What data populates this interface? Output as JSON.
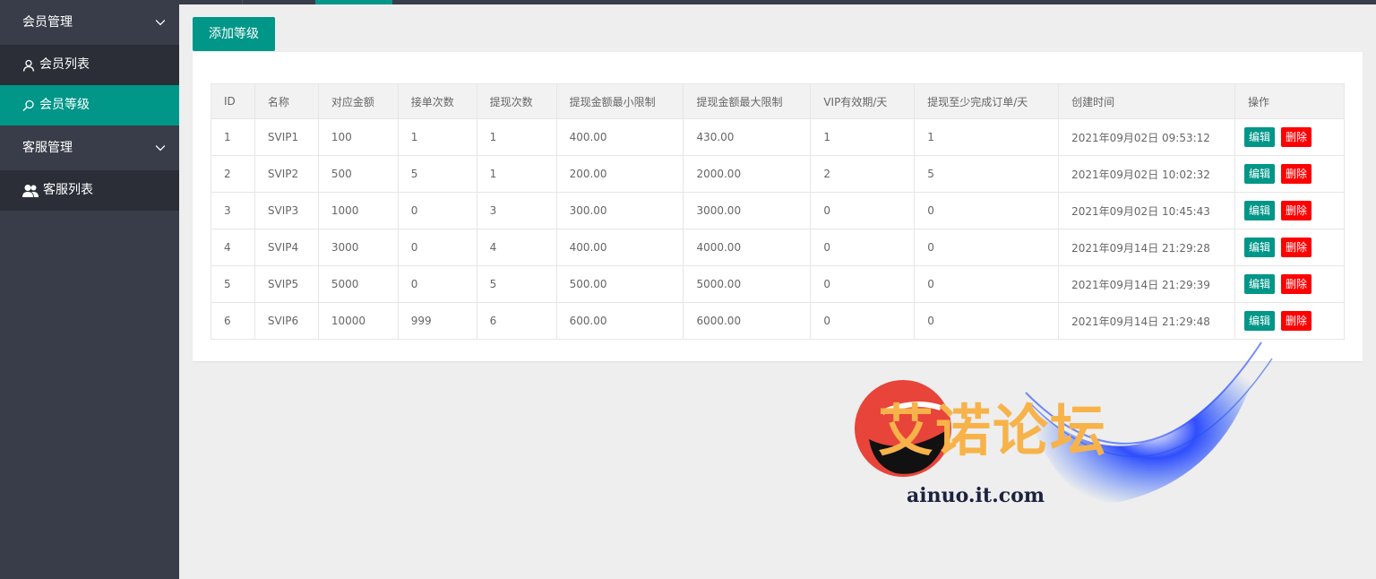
{
  "sidebar": {
    "groups": [
      {
        "label": "会员管理",
        "items": [
          {
            "label": "会员列表"
          },
          {
            "label": "会员等级"
          }
        ]
      },
      {
        "label": "客服管理",
        "items": [
          {
            "label": "客服列表"
          }
        ]
      }
    ],
    "active_item": "会员等级"
  },
  "toolbar": {
    "add_label": "添加等级"
  },
  "table": {
    "columns": [
      "ID",
      "名称",
      "对应金额",
      "接单次数",
      "提现次数",
      "提现金额最小限制",
      "提现金额最大限制",
      "VIP有效期/天",
      "提现至少完成订单/天",
      "创建时间",
      "操作"
    ],
    "rows": [
      [
        "1",
        "SVIP1",
        "100",
        "1",
        "1",
        "400.00",
        "430.00",
        "1",
        "1",
        "2021年09月02日 09:53:12"
      ],
      [
        "2",
        "SVIP2",
        "500",
        "5",
        "1",
        "200.00",
        "2000.00",
        "2",
        "5",
        "2021年09月02日 10:02:32"
      ],
      [
        "3",
        "SVIP3",
        "1000",
        "0",
        "3",
        "300.00",
        "3000.00",
        "0",
        "0",
        "2021年09月02日 10:45:43"
      ],
      [
        "4",
        "SVIP4",
        "3000",
        "0",
        "4",
        "400.00",
        "4000.00",
        "0",
        "0",
        "2021年09月14日 21:29:28"
      ],
      [
        "5",
        "SVIP5",
        "5000",
        "0",
        "5",
        "500.00",
        "5000.00",
        "0",
        "0",
        "2021年09月14日 21:29:39"
      ],
      [
        "6",
        "SVIP6",
        "10000",
        "999",
        "6",
        "600.00",
        "6000.00",
        "0",
        "0",
        "2021年09月14日 21:29:48"
      ]
    ],
    "row_actions": {
      "edit": "编辑",
      "delete": "删除"
    }
  },
  "watermark": {
    "title": "艾诺论坛",
    "url": "ainuo.it.com"
  },
  "colors": {
    "sidebar": "#393d49",
    "sidebar_sub": "#2b2e37",
    "accent": "#009688",
    "danger": "#ff0000",
    "watermark_text": "#f7b34a"
  }
}
